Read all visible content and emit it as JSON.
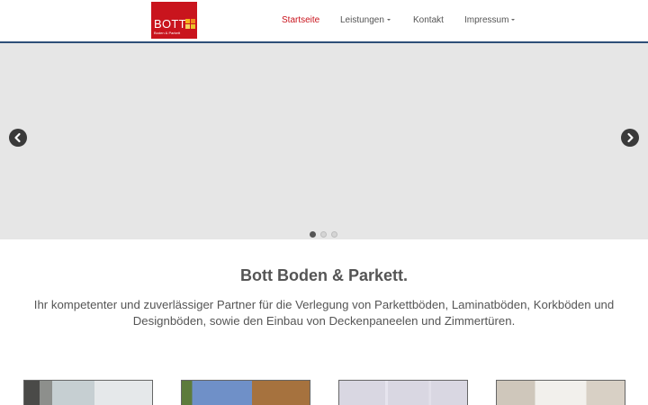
{
  "brand": {
    "name": "BOTT",
    "tagline": "Boden & Parkett",
    "color": "#c9141d",
    "icon": "square-grid-logo"
  },
  "nav": {
    "items": [
      {
        "label": "Startseite",
        "active": true
      },
      {
        "label": "Leistungen",
        "dropdown": true
      },
      {
        "label": "Kontakt"
      },
      {
        "label": "Impressum",
        "dropdown": true
      }
    ]
  },
  "carousel": {
    "prev_icon": "chevron-left-icon",
    "next_icon": "chevron-right-icon",
    "slide_count": 3,
    "active_slide": 1
  },
  "main": {
    "headline": "Bott Boden & Parkett.",
    "intro": "Ihr kompetenter und zuverlässiger Partner für die Verlegung von Parkettböden, Laminatböden, Korkböden und Designböden, sowie den Einbau von Deckenpaneelen und Zimmertüren."
  },
  "colors": {
    "accent": "#c9141d",
    "navbar_border": "#2e4f78",
    "carousel_bg": "#e6e6e6"
  }
}
